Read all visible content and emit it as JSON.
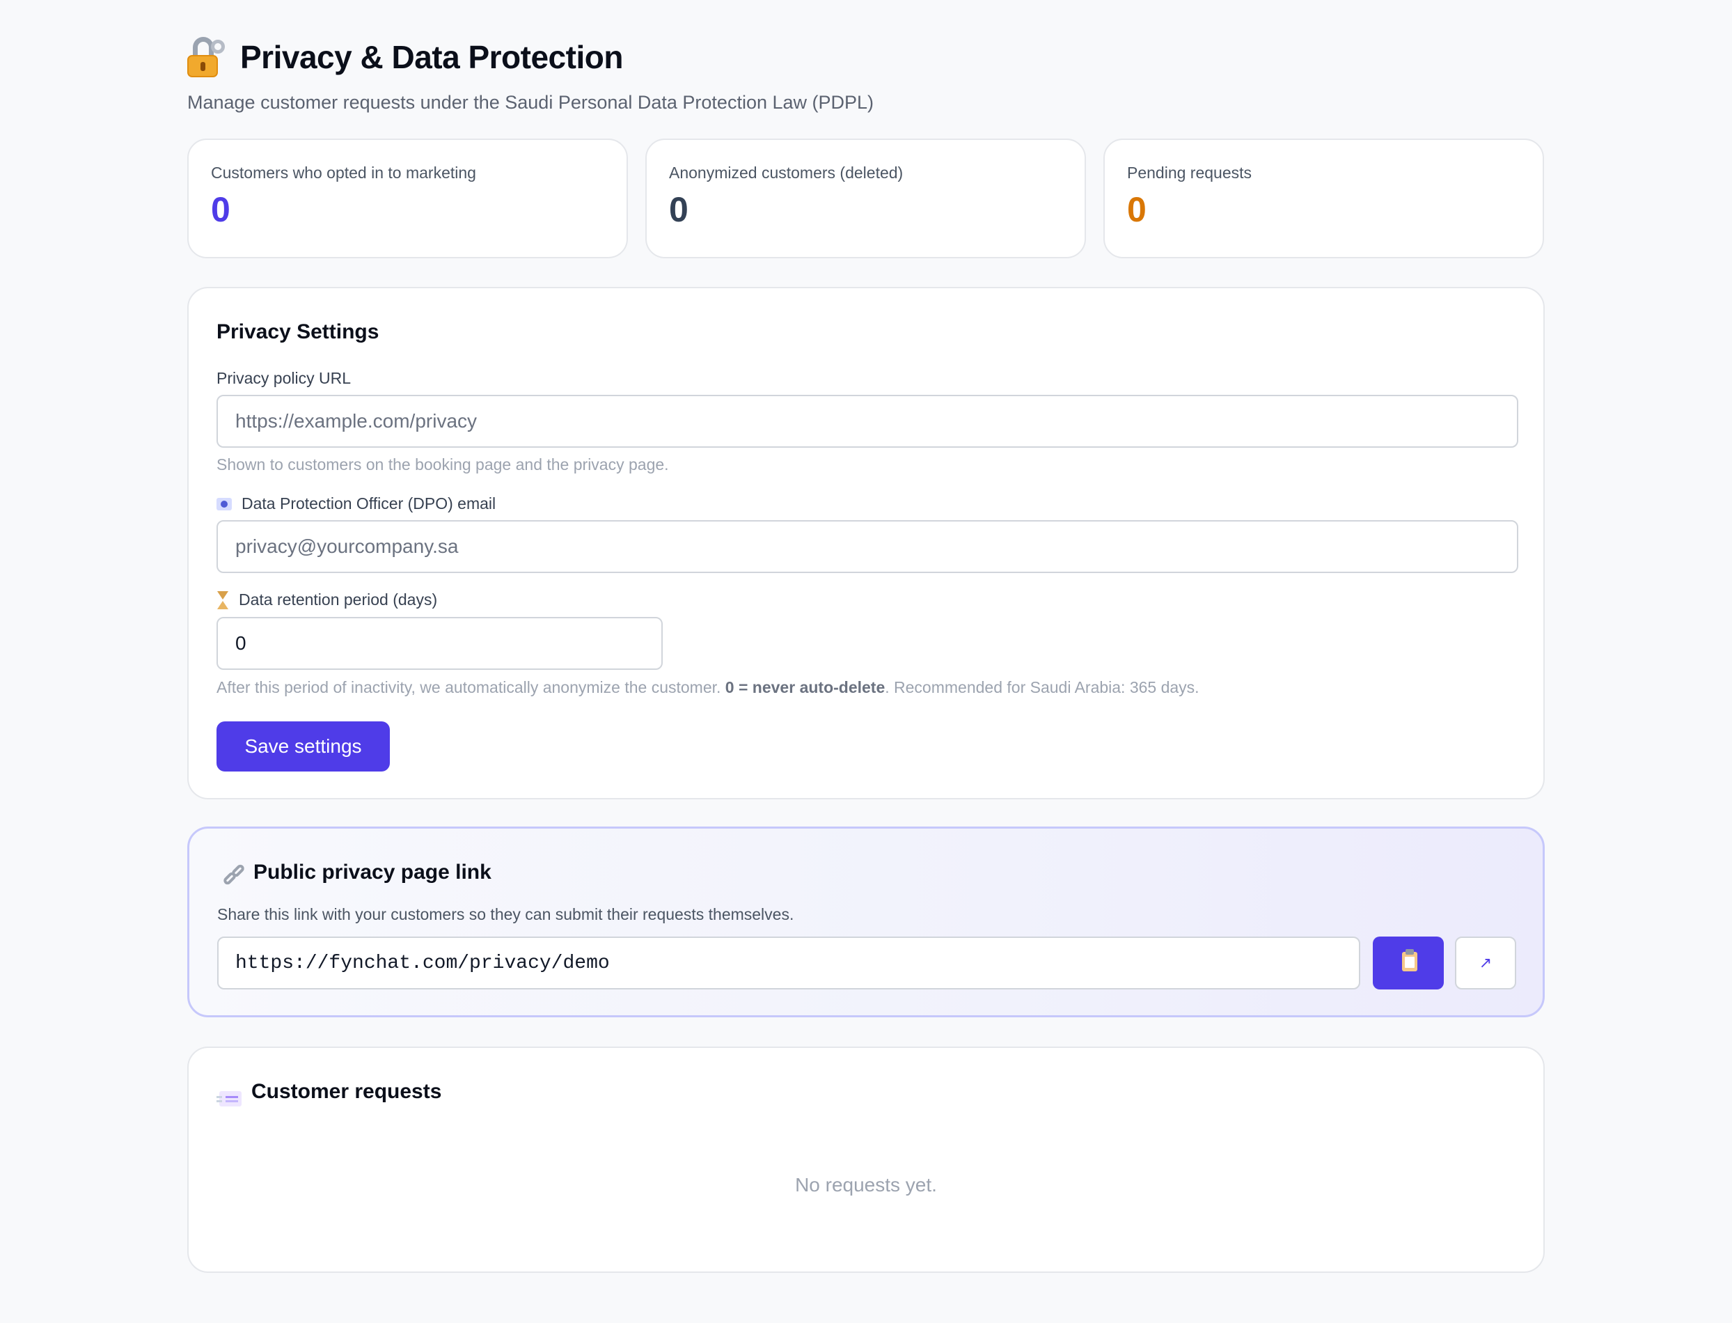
{
  "header": {
    "icon": "lock-with-key-icon",
    "title": "Privacy & Data Protection",
    "subtitle": "Manage customer requests under the Saudi Personal Data Protection Law (PDPL)"
  },
  "stats": [
    {
      "label": "Customers who opted in to marketing",
      "value": "0",
      "color": "#4f3ce8"
    },
    {
      "label": "Anonymized customers (deleted)",
      "value": "0",
      "color": "#334155"
    },
    {
      "label": "Pending requests",
      "value": "0",
      "color": "#d97706"
    }
  ],
  "settings": {
    "title": "Privacy Settings",
    "privacy_policy_label": "Privacy policy URL",
    "privacy_policy_placeholder": "https://example.com/privacy",
    "privacy_policy_hint": "Shown to customers on the booking page and the privacy page.",
    "dpo_icon": "id-card-icon",
    "dpo_label": "Data Protection Officer (DPO) email",
    "dpo_placeholder": "privacy@yourcompany.sa",
    "retention_icon": "hourglass-icon",
    "retention_label": "Data retention period (days)",
    "retention_value": "0",
    "retention_hint_before": "After this period of inactivity, we automatically anonymize the customer. ",
    "retention_hint_bold": "0 = never auto-delete",
    "retention_hint_after": ". Recommended for Saudi Arabia: 365 days.",
    "save_label": "Save settings"
  },
  "public_link": {
    "icon": "link-icon",
    "title": "Public privacy page link",
    "description": "Share this link with your customers so they can submit their requests themselves.",
    "url": "https://fynchat.com/privacy/demo",
    "copy_icon": "clipboard-icon",
    "open_icon": "↗",
    "accent": "#4f3ce8"
  },
  "requests": {
    "icon": "incoming-envelope-icon",
    "title": "Customer requests",
    "empty_text": "No requests yet."
  }
}
